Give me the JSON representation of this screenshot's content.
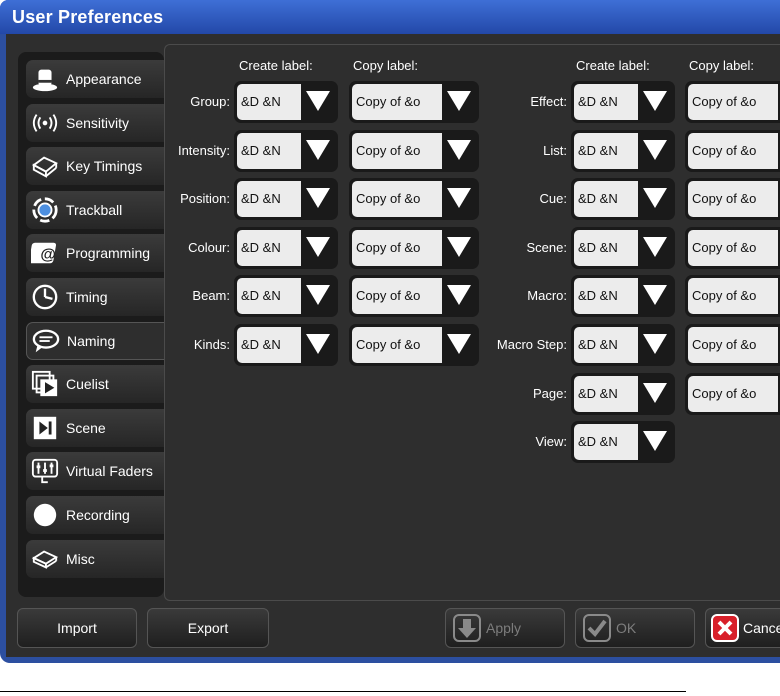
{
  "window": {
    "title": "User Preferences"
  },
  "sidebar": {
    "items": [
      {
        "label": "Appearance",
        "icon": "hat-icon"
      },
      {
        "label": "Sensitivity",
        "icon": "signal-icon"
      },
      {
        "label": "Key Timings",
        "icon": "key-icon"
      },
      {
        "label": "Trackball",
        "icon": "trackball-icon"
      },
      {
        "label": "Programming",
        "icon": "programming-icon"
      },
      {
        "label": "Timing",
        "icon": "clock-icon"
      },
      {
        "label": "Naming",
        "icon": "speech-bubble-icon",
        "active": true
      },
      {
        "label": "Cuelist",
        "icon": "cuelist-icon"
      },
      {
        "label": "Scene",
        "icon": "scene-icon"
      },
      {
        "label": "Virtual Faders",
        "icon": "faders-icon"
      },
      {
        "label": "Recording",
        "icon": "record-icon"
      },
      {
        "label": "Misc",
        "icon": "misc-icon"
      }
    ]
  },
  "naming": {
    "headers": {
      "create": "Create label:",
      "copy": "Copy label:"
    },
    "left": [
      {
        "label": "Group:",
        "create": "&D &N",
        "copy": "Copy of &o"
      },
      {
        "label": "Intensity:",
        "create": "&D &N",
        "copy": "Copy of &o"
      },
      {
        "label": "Position:",
        "create": "&D &N",
        "copy": "Copy of &o"
      },
      {
        "label": "Colour:",
        "create": "&D &N",
        "copy": "Copy of &o"
      },
      {
        "label": "Beam:",
        "create": "&D &N",
        "copy": "Copy of &o"
      },
      {
        "label": "Kinds:",
        "create": "&D &N",
        "copy": "Copy of &o"
      }
    ],
    "right": [
      {
        "label": "Effect:",
        "create": "&D &N",
        "copy": "Copy of &o"
      },
      {
        "label": "List:",
        "create": "&D &N",
        "copy": "Copy of &o"
      },
      {
        "label": "Cue:",
        "create": "&D &N",
        "copy": "Copy of &o"
      },
      {
        "label": "Scene:",
        "create": "&D &N",
        "copy": "Copy of &o"
      },
      {
        "label": "Macro:",
        "create": "&D &N",
        "copy": "Copy of &o"
      },
      {
        "label": "Macro Step:",
        "create": "&D &N",
        "copy": "Copy of &o"
      },
      {
        "label": "Page:",
        "create": "&D &N",
        "copy": "Copy of &o"
      },
      {
        "label": "View:",
        "create": "&D &N"
      }
    ]
  },
  "buttons": {
    "import": "Import",
    "export": "Export",
    "apply": "Apply",
    "ok": "OK",
    "cancel": "Cancel"
  }
}
